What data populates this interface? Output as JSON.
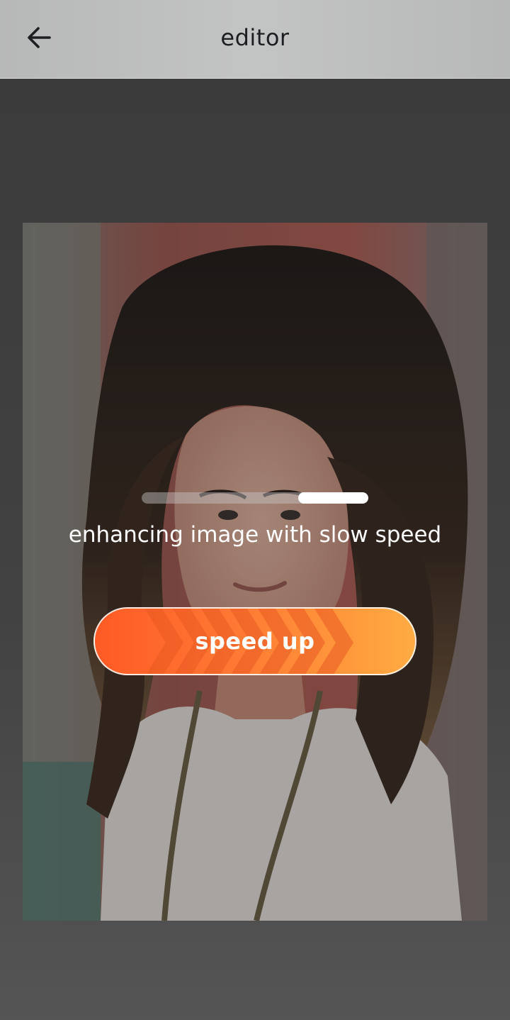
{
  "header": {
    "title": "editor",
    "back_icon": "arrow-left-icon"
  },
  "photo": {
    "subject": "portrait-photo"
  },
  "enhance": {
    "progress": 0.31,
    "status_text": "enhancing image with slow speed",
    "speed_up_label": "speed up"
  },
  "colors": {
    "button_start": "#ff5a25",
    "button_end": "#ffab42",
    "title_text": "#1c1f22"
  }
}
